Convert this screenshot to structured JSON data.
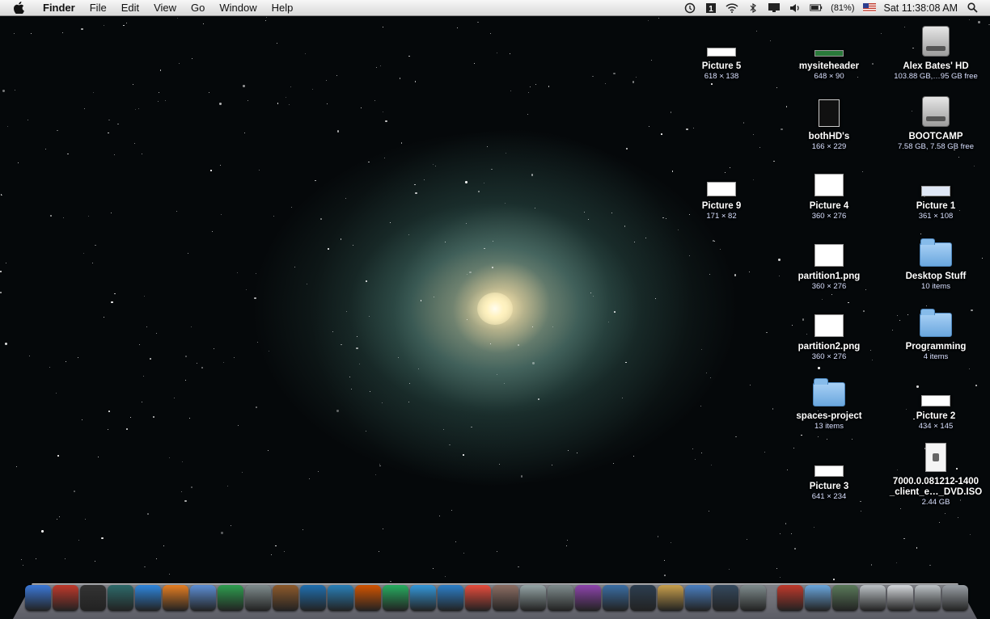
{
  "menubar": {
    "apple_icon": "apple-logo-icon",
    "app_name": "Finder",
    "menus": [
      "File",
      "Edit",
      "View",
      "Go",
      "Window",
      "Help"
    ],
    "status": {
      "time_machine_icon": "clock-icon",
      "onepassword_icon": "1-icon",
      "wifi_icon": "wifi-icon",
      "bluetooth_icon": "bluetooth-icon",
      "display_icon": "display-icon",
      "volume_icon": "speaker-icon",
      "battery_percent": "(81%)",
      "input_flag_icon": "us-flag-icon",
      "clock": "Sat 11:38:08 AM",
      "spotlight_icon": "search-icon"
    }
  },
  "desktop_icons": [
    {
      "name": "Picture 5",
      "sub": "618 × 138",
      "type": "image"
    },
    {
      "name": "mysiteheader",
      "sub": "648 × 90",
      "type": "image"
    },
    {
      "name": "Alex Bates' HD",
      "sub": "103.88 GB,…95 GB free",
      "type": "drive"
    },
    {
      "name": "bothHD's",
      "sub": "166 × 229",
      "type": "image"
    },
    {
      "name": "BOOTCAMP",
      "sub": "7.58 GB, 7.58 GB free",
      "type": "drive"
    },
    {
      "name": "Picture 9",
      "sub": "171 × 82",
      "type": "image"
    },
    {
      "name": "Picture 4",
      "sub": "360 × 276",
      "type": "image"
    },
    {
      "name": "Picture 1",
      "sub": "361 × 108",
      "type": "image"
    },
    {
      "name": "partition1.png",
      "sub": "360 × 276",
      "type": "image"
    },
    {
      "name": "Desktop Stuff",
      "sub": "10 items",
      "type": "folder"
    },
    {
      "name": "partition2.png",
      "sub": "360 × 276",
      "type": "image"
    },
    {
      "name": "Programming",
      "sub": "4 items",
      "type": "folder"
    },
    {
      "name": "spaces-project",
      "sub": "13 items",
      "type": "folder"
    },
    {
      "name": "Picture 2",
      "sub": "434 × 145",
      "type": "image"
    },
    {
      "name": "Picture 3",
      "sub": "641 × 234",
      "type": "image"
    },
    {
      "name": "7000.0.081212-1400\n_client_e…_DVD.ISO",
      "sub": "2.44 GB",
      "type": "document"
    }
  ],
  "dock": [
    {
      "icon": "finder-icon",
      "color": "#3b78d8"
    },
    {
      "icon": "parallels-icon",
      "color": "#c0392b"
    },
    {
      "icon": "dashboard-icon",
      "color": "#333333"
    },
    {
      "icon": "time-machine-icon",
      "color": "#2d6a6a"
    },
    {
      "icon": "safari-icon",
      "color": "#2e86de"
    },
    {
      "icon": "firefox-icon",
      "color": "#e67e22"
    },
    {
      "icon": "preview-icon",
      "color": "#5d8fd6"
    },
    {
      "icon": "earth-icon",
      "color": "#2e9e4f"
    },
    {
      "icon": "script-editor-icon",
      "color": "#7f8c8d"
    },
    {
      "icon": "keynote-icon",
      "color": "#8e5a2b"
    },
    {
      "icon": "grapher-icon",
      "color": "#1f6fb0"
    },
    {
      "icon": "word-icon",
      "color": "#2980b9"
    },
    {
      "icon": "powerpoint-icon",
      "color": "#d35400"
    },
    {
      "icon": "excel-icon",
      "color": "#27ae60"
    },
    {
      "icon": "itunes-icon",
      "color": "#3498db"
    },
    {
      "icon": "music-note-icon",
      "color": "#2c7fc9"
    },
    {
      "icon": "ical-icon",
      "color": "#e74c3c"
    },
    {
      "icon": "iphoto-icon",
      "color": "#8d6e63"
    },
    {
      "icon": "calculator-icon",
      "color": "#95a5a6"
    },
    {
      "icon": "printer-icon",
      "color": "#7f8c8d"
    },
    {
      "icon": "textmate-icon",
      "color": "#8e44ad"
    },
    {
      "icon": "xcode-icon",
      "color": "#3a6ea5"
    },
    {
      "icon": "iphone-icon",
      "color": "#2c3e50"
    },
    {
      "icon": "installer-icon",
      "color": "#c9a04c"
    },
    {
      "icon": "applications-icon",
      "color": "#4a7fc1"
    },
    {
      "icon": "spaces-icon",
      "color": "#34495e"
    },
    {
      "icon": "system-preferences-icon",
      "color": "#7f8c8d"
    },
    {
      "icon": "magnet-icon",
      "color": "#c0392b"
    },
    {
      "icon": "documents-folder-icon",
      "color": "#6aa7de"
    },
    {
      "icon": "picture-stack-icon",
      "color": "#5a7a5a"
    },
    {
      "icon": "window-preview-icon",
      "color": "#bdc3c7"
    },
    {
      "icon": "window-preview-icon",
      "color": "#d5d8dc"
    },
    {
      "icon": "window-preview-icon",
      "color": "#bdc3c7"
    },
    {
      "icon": "trash-icon",
      "color": "#9aa0a6"
    }
  ]
}
